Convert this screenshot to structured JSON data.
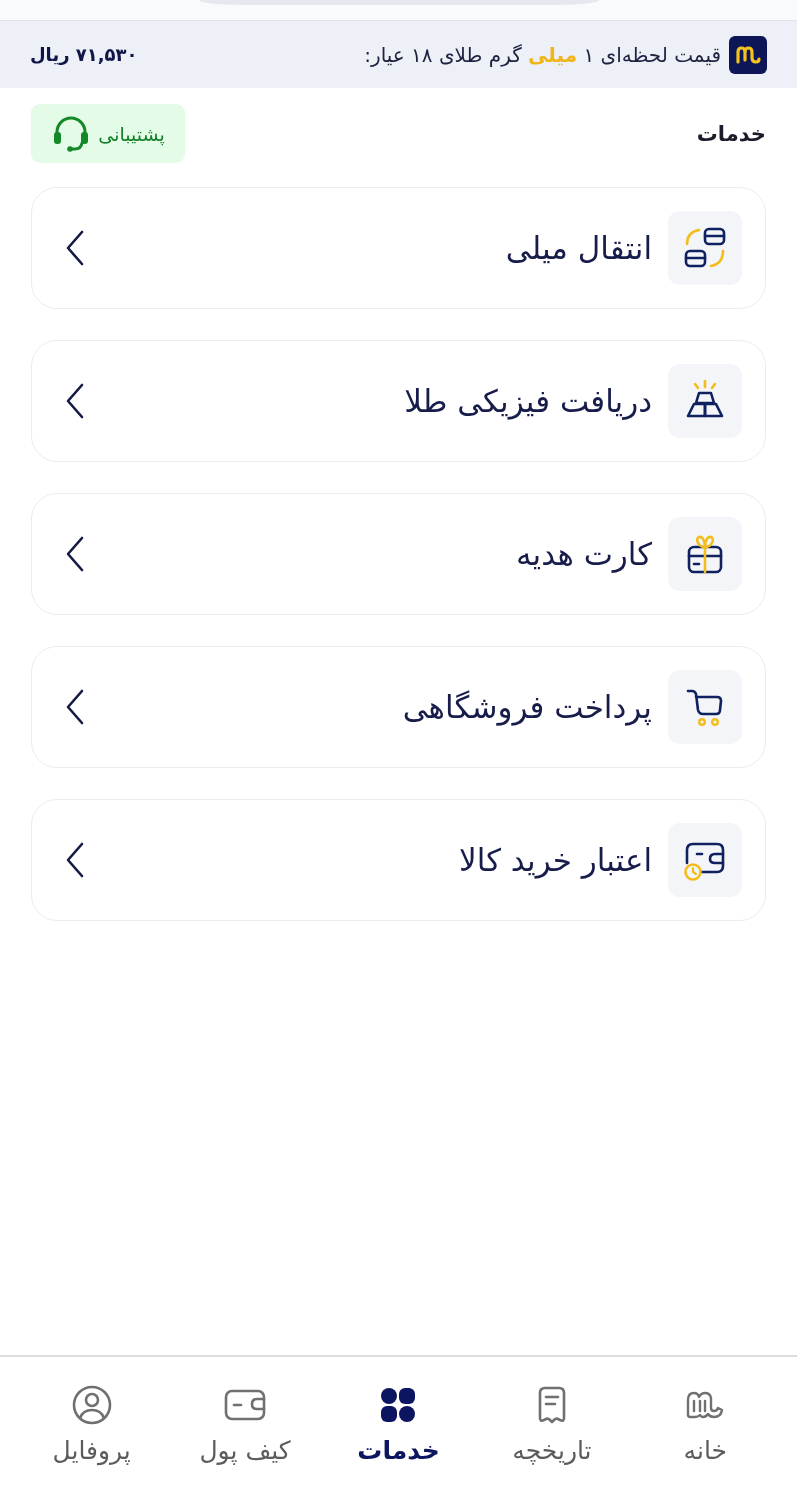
{
  "price_banner": {
    "label": "قیمت لحظه‌ای ۱ **میلی** گرم طلای ۱۸ عیار:",
    "price": "۷۱,۵۳۰ ریال"
  },
  "section": {
    "title": "خدمات",
    "support_button": "پشتیبانی"
  },
  "services": [
    {
      "kind": "transfer",
      "title": "انتقال میلی"
    },
    {
      "kind": "bullion",
      "title": "دریافت فیزیکی طلا"
    },
    {
      "kind": "gift",
      "title": "کارت هدیه"
    },
    {
      "kind": "cart",
      "title": "پرداخت فروشگاهی"
    },
    {
      "kind": "credit",
      "title": "اعتبار خرید کالا"
    }
  ],
  "bottom_nav": [
    {
      "kind": "home",
      "label": "خانه",
      "selected": false
    },
    {
      "kind": "history",
      "label": "تاریخچه",
      "selected": false
    },
    {
      "kind": "services",
      "label": "خدمات",
      "selected": true
    },
    {
      "kind": "wallet",
      "label": "کیف پول",
      "selected": false
    },
    {
      "kind": "profile",
      "label": "پروفایل",
      "selected": false
    }
  ]
}
